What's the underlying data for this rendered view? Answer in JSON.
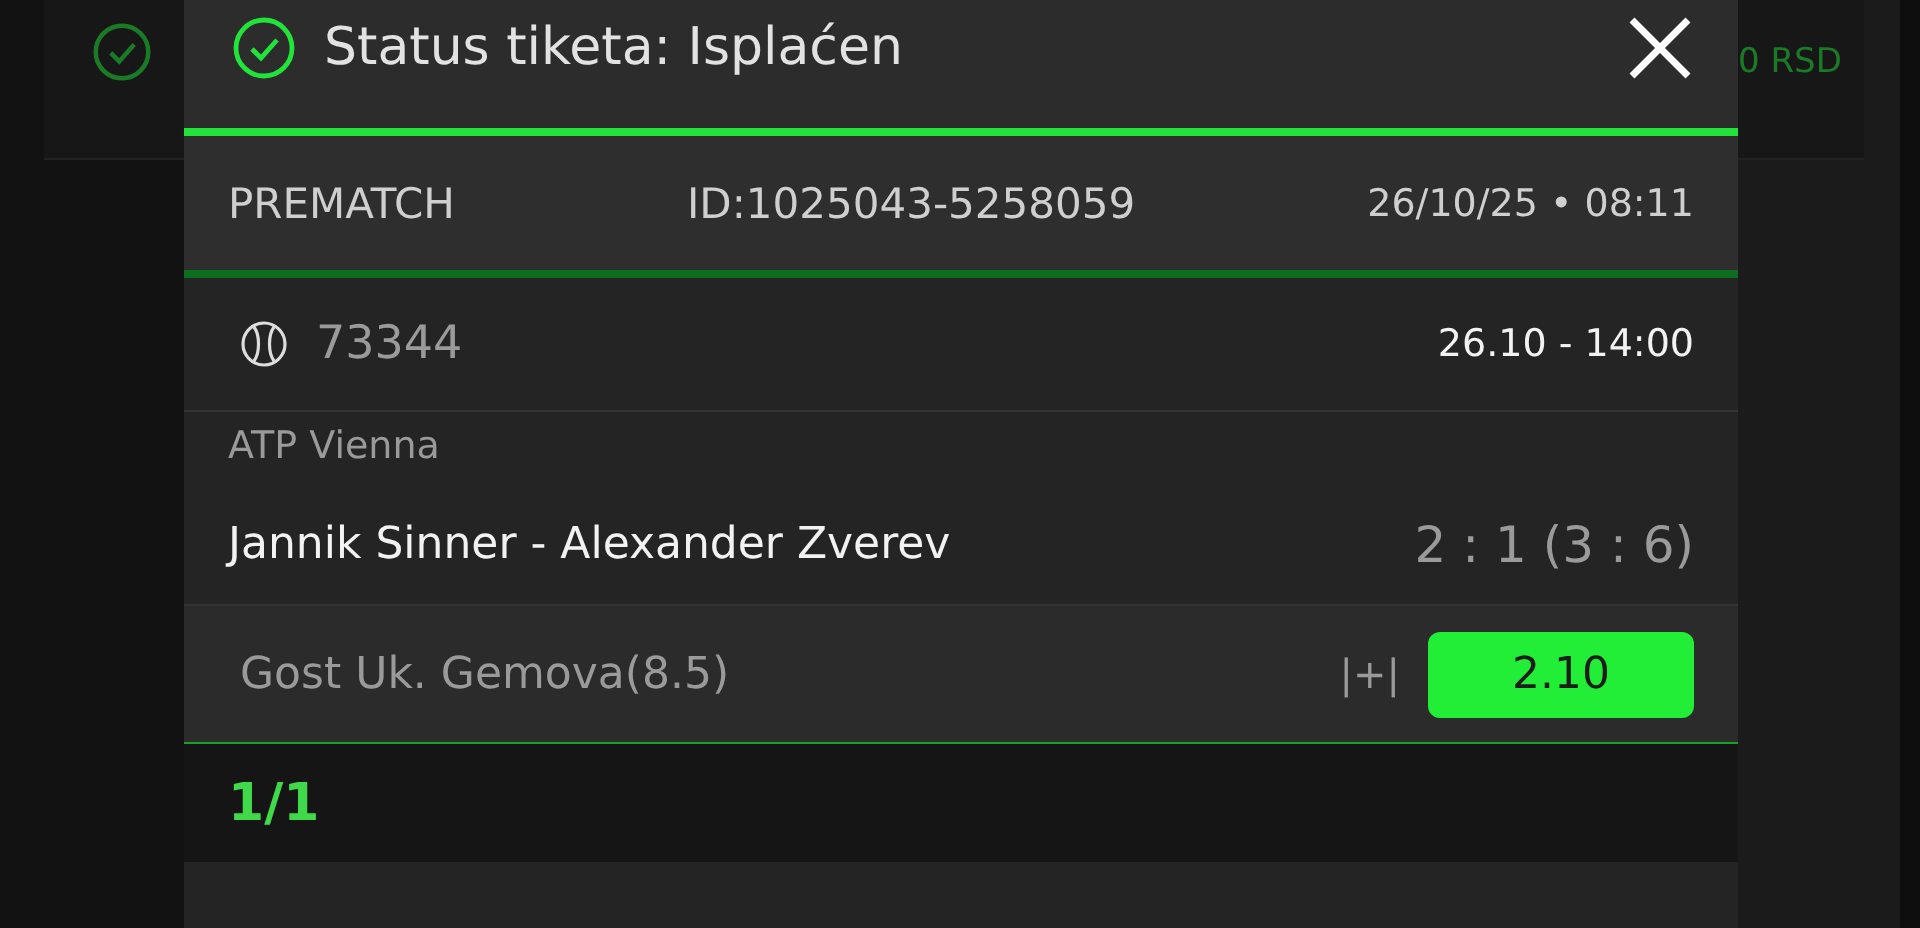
{
  "background": {
    "amount": "0 RSD"
  },
  "modal": {
    "title": "Status tiketa: Isplaćen",
    "paid": true,
    "ticket": {
      "type": "PREMATCH",
      "id": "ID:1025043-5258059",
      "date": "26/10/25 • 08:11"
    },
    "events": [
      {
        "kind": "tennis",
        "code": "73344",
        "time": "26.10  -  14:00",
        "league": "ATP Vienna",
        "match": "Jannik Sinner - Alexander Zverev",
        "score": "2 : 1 (3 : 6)",
        "bet": "Gost Uk. Gemova(8.5)",
        "marker": "|+|",
        "odds": "2.10",
        "won": true
      }
    ],
    "counter": "1/1"
  }
}
